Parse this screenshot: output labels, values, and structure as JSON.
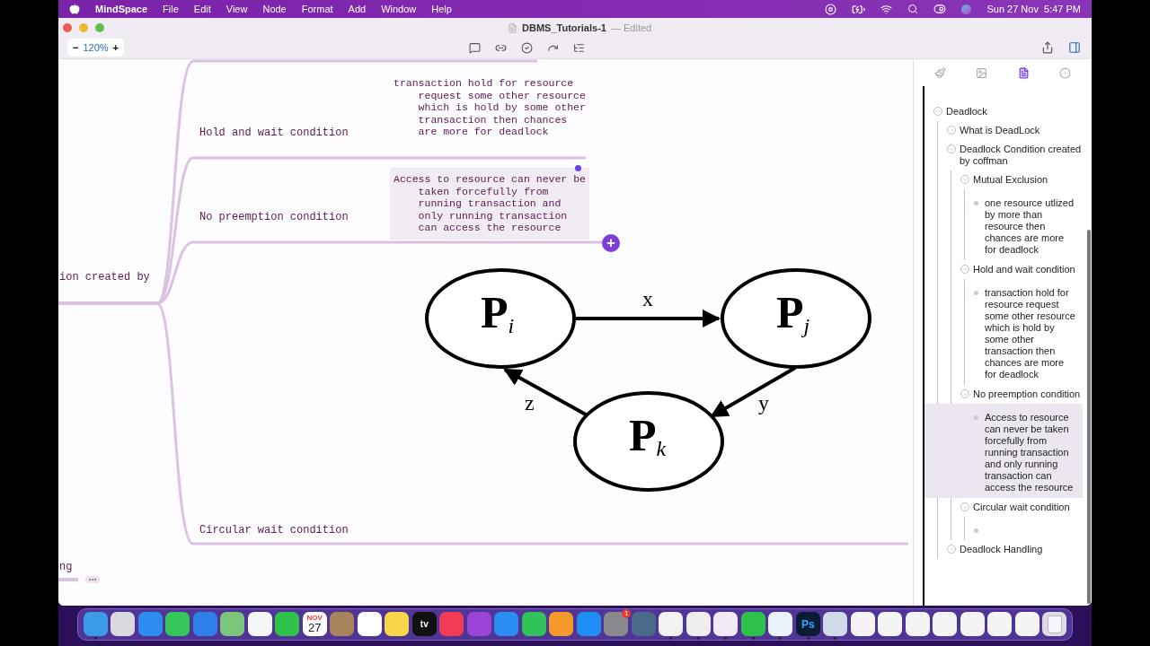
{
  "menu_bar": {
    "app": "MindSpace",
    "menus": [
      "File",
      "Edit",
      "View",
      "Node",
      "Format",
      "Add",
      "Window",
      "Help"
    ],
    "clock": "Sun 27 Nov  5:47 PM"
  },
  "window": {
    "title": "DBMS_Tutorials-1",
    "status": "— Edited",
    "zoom": "120%",
    "zoom_out": "−",
    "zoom_in": "+"
  },
  "canvas": {
    "topics": [
      {
        "text": "ion created by"
      },
      {
        "text": "Hold and wait condition"
      },
      {
        "text": "No preemption condition"
      },
      {
        "text": "Circular wait condition"
      },
      {
        "text": "ng"
      }
    ],
    "notes": [
      {
        "text": "transaction hold for resource request some other resource which is hold by some other transaction then chances are more for deadlock",
        "selected": false
      },
      {
        "text": "Access to resource can never be taken forcefully from running transaction and only running transaction can access the resource",
        "selected": true
      }
    ],
    "add_button": "+",
    "diagram": {
      "nodes": [
        "P$_{i}$",
        "P$_{j}$",
        "P$_{k}$"
      ],
      "edges": [
        "x",
        "y",
        "z"
      ]
    }
  },
  "inspector_tabs": [
    {
      "kind": "style",
      "selected": false
    },
    {
      "kind": "image",
      "selected": false
    },
    {
      "kind": "outline",
      "selected": true
    },
    {
      "kind": "more",
      "selected": false
    }
  ],
  "outline": [
    {
      "text": "Deadlock",
      "kind": "topic",
      "expanded": true,
      "selected": false,
      "children": [
        {
          "text": "What is DeadLock",
          "kind": "topic",
          "expanded": false,
          "selected": false
        },
        {
          "text": "Deadlock Condition created by coffman",
          "kind": "topic",
          "expanded": true,
          "selected": false,
          "children": [
            {
              "text": "Mutual Exclusion",
              "kind": "topic",
              "expanded": true,
              "selected": false,
              "children": [
                {
                  "text": "one resource utlized by more than resource then chances are more for deadlock",
                  "kind": "note",
                  "selected": false
                }
              ]
            },
            {
              "text": "Hold and wait condition",
              "kind": "topic",
              "expanded": true,
              "selected": false,
              "children": [
                {
                  "text": "transaction hold for resource request some other resource which is hold by some other transaction then chances are more for deadlock",
                  "kind": "note",
                  "selected": false
                }
              ]
            },
            {
              "text": "No preemption condition",
              "kind": "topic",
              "expanded": true,
              "selected": false,
              "children": [
                {
                  "text": "Access to resource can never be taken forcefully from running transaction and only running transaction can access the resource",
                  "kind": "note",
                  "selected": true
                }
              ]
            },
            {
              "text": "Circular wait condition",
              "kind": "topic",
              "expanded": true,
              "selected": false,
              "children": [
                {
                  "kind": "note",
                  "selected": false
                }
              ]
            }
          ]
        },
        {
          "text": "Deadlock Handling",
          "kind": "topic",
          "expanded": false,
          "selected": false
        }
      ]
    }
  ],
  "dock": [
    {
      "kind": "finder",
      "running": true
    },
    {
      "kind": "launchpad",
      "running": false
    },
    {
      "kind": "safari",
      "running": false
    },
    {
      "kind": "messages",
      "running": false
    },
    {
      "kind": "mail",
      "running": false
    },
    {
      "kind": "maps",
      "running": false
    },
    {
      "kind": "photos",
      "running": false
    },
    {
      "kind": "facetime",
      "running": false
    },
    {
      "kind": "calendar",
      "month": "NOV",
      "day": "27",
      "running": false
    },
    {
      "kind": "contacts",
      "running": false
    },
    {
      "kind": "reminders",
      "running": false
    },
    {
      "kind": "notes",
      "running": false
    },
    {
      "kind": "tv",
      "label": "tv",
      "running": false
    },
    {
      "kind": "music",
      "running": false
    },
    {
      "kind": "podcasts",
      "running": false
    },
    {
      "kind": "keynote",
      "running": false
    },
    {
      "kind": "numbers",
      "running": false
    },
    {
      "kind": "pages",
      "running": false
    },
    {
      "kind": "appstore",
      "running": false
    },
    {
      "kind": "settings",
      "badge": "1",
      "running": false
    },
    {
      "kind": "quicktime",
      "running": false
    },
    {
      "kind": "chrome",
      "running": true
    },
    {
      "kind": "pen",
      "running": true
    },
    {
      "kind": "cube",
      "running": true
    },
    {
      "kind": "whatsapp",
      "running": true
    },
    {
      "kind": "share",
      "running": true
    },
    {
      "kind": "photoshop",
      "label": "Ps",
      "running": true
    },
    {
      "kind": "preview",
      "running": true
    },
    {
      "kind": "document",
      "running": false
    },
    {
      "kind": "document",
      "running": false
    },
    {
      "kind": "document",
      "running": false
    },
    {
      "kind": "document",
      "running": false
    },
    {
      "kind": "document",
      "running": false
    },
    {
      "kind": "document",
      "running": false
    },
    {
      "kind": "document",
      "running": false
    },
    {
      "kind": "trash",
      "running": false
    }
  ]
}
